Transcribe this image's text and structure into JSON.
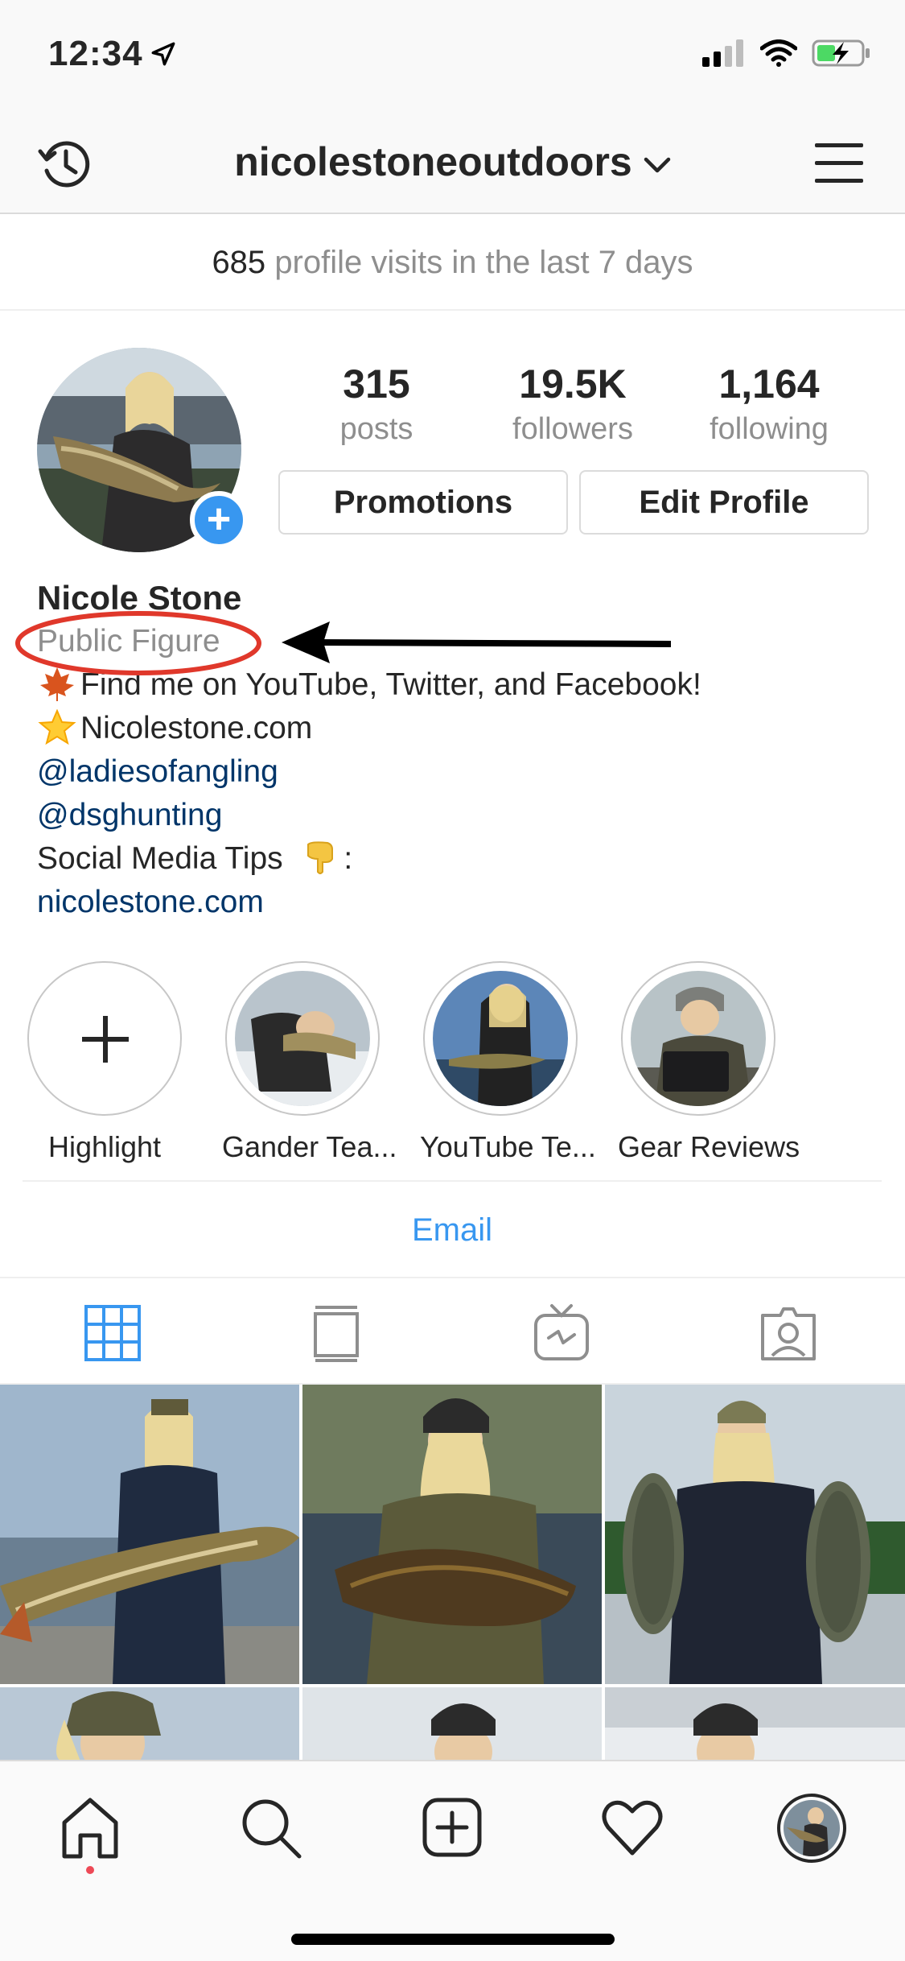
{
  "status_bar": {
    "time": "12:34"
  },
  "header": {
    "username": "nicolestoneoutdoors"
  },
  "visits": {
    "count": "685",
    "text": "profile visits in the last 7 days"
  },
  "stats": [
    {
      "value": "315",
      "label": "posts"
    },
    {
      "value": "19.5K",
      "label": "followers"
    },
    {
      "value": "1,164",
      "label": "following"
    }
  ],
  "actions": {
    "promotions": "Promotions",
    "edit_profile": "Edit Profile"
  },
  "bio": {
    "name": "Nicole Stone",
    "category": "Public Figure",
    "line1": "Find me on YouTube, Twitter, and Facebook!",
    "line2": "Nicolestone.com",
    "mention1": "@ladiesofangling",
    "mention2": "@dsghunting",
    "line5": "Social Media Tips",
    "line5_suffix": ":",
    "website": "nicolestone.com",
    "emoji1": "maple-leaf",
    "emoji2": "glowing-star",
    "emoji3": "pointing-down-hand"
  },
  "highlights": [
    {
      "label": "Highlight",
      "icon": "plus-icon"
    },
    {
      "label": "Gander Tea..."
    },
    {
      "label": "YouTube Te..."
    },
    {
      "label": "Gear Reviews"
    }
  ],
  "contact": {
    "email": "Email"
  },
  "tabs": [
    "grid-icon",
    "feed-icon",
    "igtv-icon",
    "tagged-icon"
  ],
  "bottom_nav": [
    "home-icon",
    "search-icon",
    "new-post-icon",
    "activity-heart-icon",
    "profile-avatar"
  ],
  "colors": {
    "accent": "#3897f0",
    "link": "#003569",
    "annotation": "#e0382b",
    "notification_dot": "#ed4956"
  }
}
